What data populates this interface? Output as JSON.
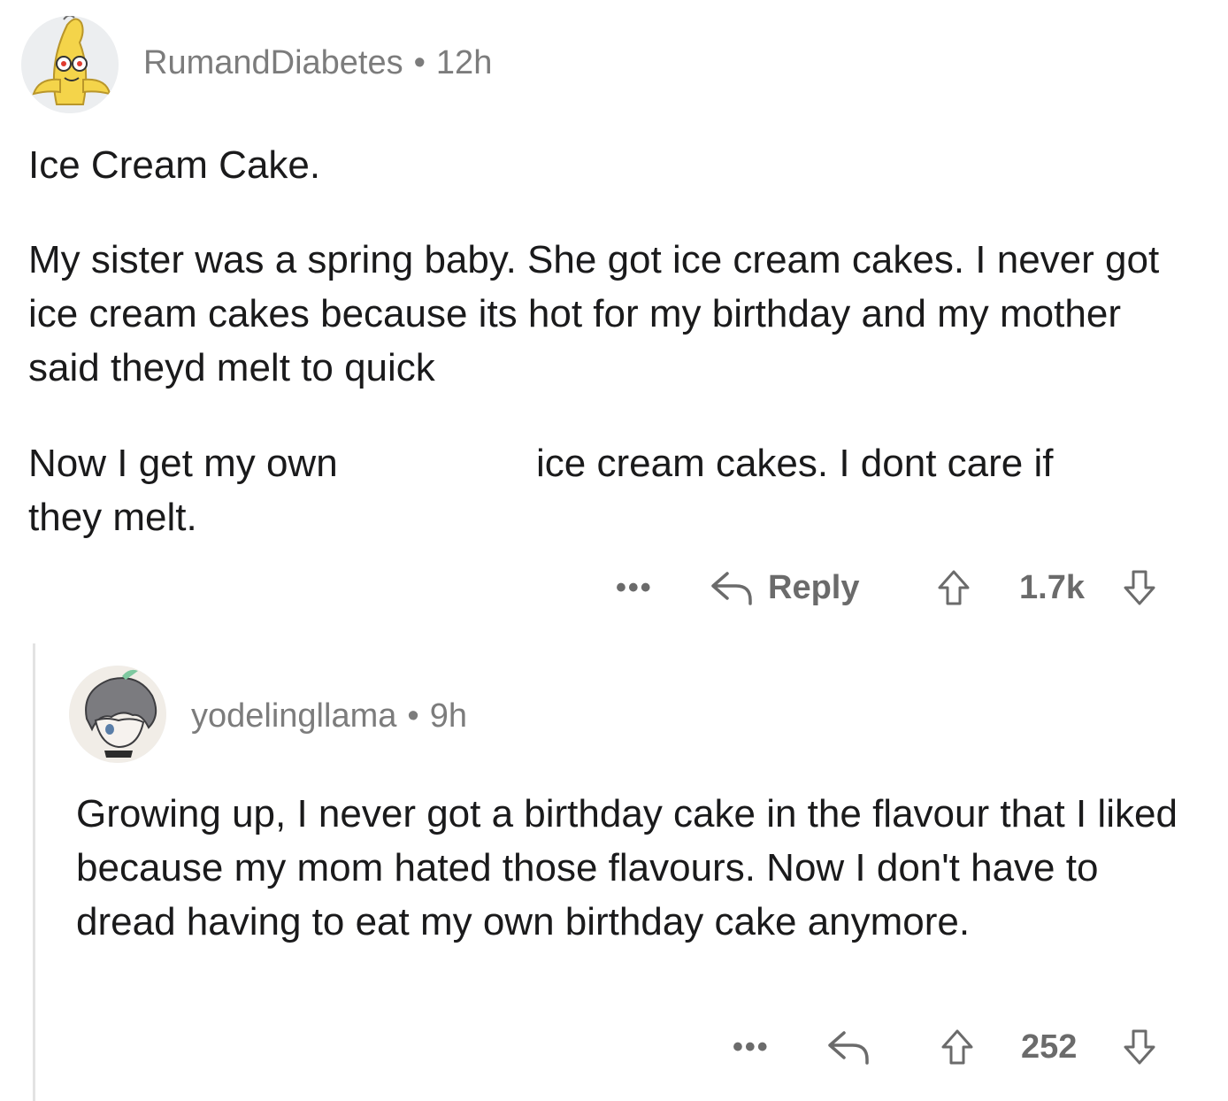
{
  "comment": {
    "author": "RumandDiabetes",
    "separator": "•",
    "time": "12h",
    "paragraphs": [
      "Ice Cream Cake.",
      "My sister was a spring baby. She got ice cream cakes. I never got ice cream cakes because its hot for my birthday and my mother said theyd melt to quick",
      "Now I get my own",
      "ice cream cakes. I dont care if",
      "they melt."
    ],
    "actions": {
      "more": "•••",
      "reply": "Reply",
      "score": "1.7k"
    }
  },
  "reply": {
    "author": "yodelingllama",
    "separator": "•",
    "time": "9h",
    "paragraphs": [
      "Growing up, I never got a birthday cake in the flavour that I liked because my mom hated those flavours. Now I don't have to dread having to eat my own birthday cake anymore."
    ],
    "actions": {
      "more": "•••",
      "score": "252"
    }
  },
  "colors": {
    "meta_text": "#7c7c7c",
    "action_text": "#6b6b6b",
    "thread_line": "#e3e3e3"
  },
  "icons": [
    "avatar-banana",
    "avatar-anime-character",
    "reply-arrow-icon",
    "upvote-icon",
    "downvote-icon",
    "more-options-icon"
  ]
}
